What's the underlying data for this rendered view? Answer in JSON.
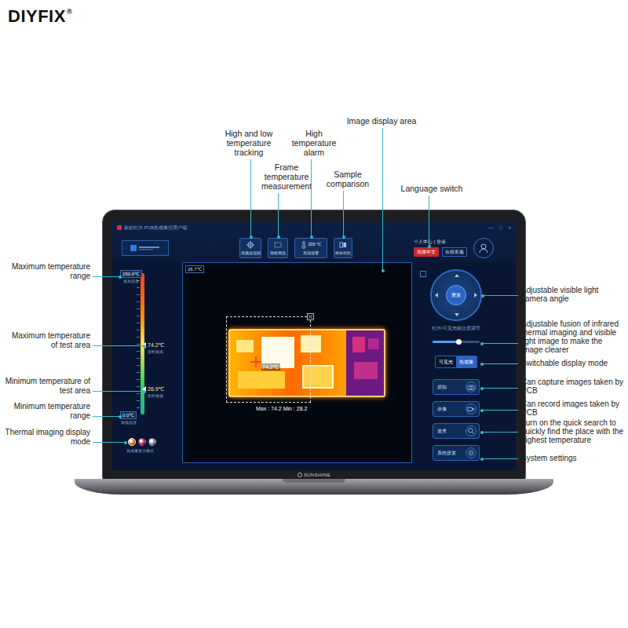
{
  "brand": {
    "name": "DIYFIX",
    "mark": "®"
  },
  "callouts": {
    "top": [
      {
        "text": "High and low temperature tracking"
      },
      {
        "text": "Frame temperature measurement"
      },
      {
        "text": "High temperature alarm"
      },
      {
        "text": "Sample comparison"
      },
      {
        "text": "Image display area"
      },
      {
        "text": "Language switch"
      }
    ],
    "left": [
      {
        "text": "Maximum temperature range"
      },
      {
        "text": "Maximum temperature of test area"
      },
      {
        "text": "Minimum temperature of test area"
      },
      {
        "text": "Minimum temperature range"
      },
      {
        "text": "Thermal imaging display mode"
      }
    ],
    "right": [
      {
        "text": "Adjustable visible light camera angle"
      },
      {
        "text": "Adjustable fusion of infrared thermal imaging and visible light image to make the image clearer"
      },
      {
        "text": "Switchable display mode"
      },
      {
        "text": "Can capture images taken by PCB"
      },
      {
        "text": "Can record images taken by PCB"
      },
      {
        "text": "Turn on the quick search to quickly find the place with the highest temperature"
      },
      {
        "text": "System settings"
      }
    ]
  },
  "app": {
    "title": "新款红外 PCB热成像仪用户端",
    "window_controls": [
      "—",
      "□",
      "×"
    ],
    "toolbar": [
      {
        "label": "高低温追踪"
      },
      {
        "label": "画框测温"
      },
      {
        "label": "高温报警",
        "value": "200 ℃"
      },
      {
        "label": "样本对比"
      }
    ],
    "account": "个人中心 | 登录",
    "language": "简体中文",
    "service": "在线客服",
    "scale": {
      "max": "150.0℃",
      "max_label": "最高温度",
      "min": "0.0℃",
      "min_label": "最低温度",
      "markers": [
        {
          "reading": "74.2℃",
          "label": "实时最高",
          "level": 0.49
        },
        {
          "reading": "26.9℃",
          "label": "实时最低",
          "level": 0.18
        }
      ]
    },
    "modes": {
      "label": "热成像显示模式",
      "items": [
        {
          "selected": true,
          "color": "#ff7a00"
        },
        {
          "selected": false,
          "color": "#d8307a"
        },
        {
          "selected": false,
          "color": "#9aa4b8"
        }
      ]
    },
    "image": {
      "ambient": "26.7℃",
      "cursor": "74.2℃",
      "stats": "Max : 74.2 Min : 28.2"
    },
    "camera": {
      "reset": "重置"
    },
    "fusion": {
      "label": "红外/可见光融合度调节",
      "level": 0.55
    },
    "display_modes": [
      {
        "label": "可见光",
        "selected": false
      },
      {
        "label": "热成像",
        "selected": true
      }
    ],
    "actions": [
      {
        "label": "抓拍"
      },
      {
        "label": "录像"
      },
      {
        "label": "速查"
      },
      {
        "label": "系统设置"
      }
    ]
  },
  "laptop": {
    "brand": "SUNSHINE"
  }
}
